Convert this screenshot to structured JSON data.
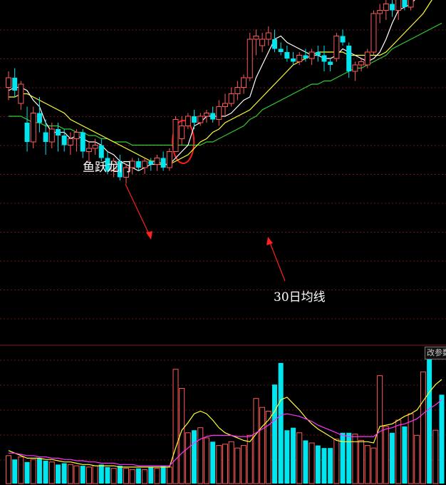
{
  "annotations": {
    "fish_leap": "鱼跃龙门",
    "ma30": "30日均线"
  },
  "volume_panel": {
    "button_label": "改参数"
  },
  "colors": {
    "up": "#ff5a5a",
    "down": "#00e5ee",
    "ma5": "#ffffff",
    "ma10": "#ffff33",
    "ma30": "#33cc33",
    "vol_ma1": "#ffff33",
    "vol_ma2": "#ff33ff",
    "grid": "#6e1414",
    "circle": "#ff1a1a",
    "arrow": "#ff2020"
  },
  "chart_data": {
    "type": "candlestick",
    "price_range": [
      0,
      100
    ],
    "volume_range": [
      0,
      100
    ],
    "grid": true,
    "candles": [
      {
        "o": 75,
        "h": 80,
        "l": 71,
        "c": 78
      },
      {
        "o": 78,
        "h": 81,
        "l": 72,
        "c": 74
      },
      {
        "o": 70,
        "h": 77,
        "l": 68,
        "c": 76
      },
      {
        "o": 64,
        "h": 69,
        "l": 55,
        "c": 58
      },
      {
        "o": 58,
        "h": 69,
        "l": 56,
        "c": 67
      },
      {
        "o": 67,
        "h": 72,
        "l": 61,
        "c": 64
      },
      {
        "o": 61,
        "h": 65,
        "l": 54,
        "c": 58
      },
      {
        "o": 58,
        "h": 64,
        "l": 56,
        "c": 62
      },
      {
        "o": 62,
        "h": 64,
        "l": 55,
        "c": 60
      },
      {
        "o": 60,
        "h": 62,
        "l": 55,
        "c": 57
      },
      {
        "o": 57,
        "h": 61,
        "l": 54,
        "c": 59
      },
      {
        "o": 59,
        "h": 62,
        "l": 55,
        "c": 61
      },
      {
        "o": 61,
        "h": 62,
        "l": 53,
        "c": 55
      },
      {
        "o": 55,
        "h": 58,
        "l": 52,
        "c": 56
      },
      {
        "o": 56,
        "h": 59,
        "l": 54,
        "c": 57
      },
      {
        "o": 57,
        "h": 59,
        "l": 52,
        "c": 53
      },
      {
        "o": 53,
        "h": 55,
        "l": 48,
        "c": 49
      },
      {
        "o": 49,
        "h": 53,
        "l": 47,
        "c": 52
      },
      {
        "o": 52,
        "h": 54,
        "l": 46,
        "c": 47
      },
      {
        "o": 47,
        "h": 51,
        "l": 45,
        "c": 50
      },
      {
        "o": 50,
        "h": 53,
        "l": 48,
        "c": 52
      },
      {
        "o": 52,
        "h": 53,
        "l": 49,
        "c": 50
      },
      {
        "o": 50,
        "h": 53,
        "l": 48,
        "c": 52
      },
      {
        "o": 52,
        "h": 53,
        "l": 49,
        "c": 51
      },
      {
        "o": 51,
        "h": 54,
        "l": 49,
        "c": 53
      },
      {
        "o": 53,
        "h": 55,
        "l": 49,
        "c": 50
      },
      {
        "o": 50,
        "h": 56,
        "l": 49,
        "c": 55
      },
      {
        "o": 55,
        "h": 66,
        "l": 55,
        "c": 65
      },
      {
        "o": 59,
        "h": 66,
        "l": 57,
        "c": 63
      },
      {
        "o": 63,
        "h": 67,
        "l": 62,
        "c": 66
      },
      {
        "o": 66,
        "h": 68,
        "l": 62,
        "c": 64
      },
      {
        "o": 64,
        "h": 67,
        "l": 63,
        "c": 66
      },
      {
        "o": 66,
        "h": 68,
        "l": 64,
        "c": 67
      },
      {
        "o": 67,
        "h": 69,
        "l": 64,
        "c": 65
      },
      {
        "o": 65,
        "h": 71,
        "l": 63,
        "c": 69
      },
      {
        "o": 69,
        "h": 73,
        "l": 66,
        "c": 70
      },
      {
        "o": 70,
        "h": 75,
        "l": 69,
        "c": 73
      },
      {
        "o": 73,
        "h": 77,
        "l": 71,
        "c": 75
      },
      {
        "o": 75,
        "h": 79,
        "l": 73,
        "c": 78
      },
      {
        "o": 78,
        "h": 92,
        "l": 77,
        "c": 90
      },
      {
        "o": 90,
        "h": 93,
        "l": 85,
        "c": 91
      },
      {
        "o": 88,
        "h": 92,
        "l": 86,
        "c": 90
      },
      {
        "o": 90,
        "h": 94,
        "l": 88,
        "c": 92
      },
      {
        "o": 90,
        "h": 93,
        "l": 86,
        "c": 87
      },
      {
        "o": 87,
        "h": 89,
        "l": 85,
        "c": 86
      },
      {
        "o": 86,
        "h": 88,
        "l": 83,
        "c": 84
      },
      {
        "o": 84,
        "h": 86,
        "l": 82,
        "c": 83
      },
      {
        "o": 83,
        "h": 86,
        "l": 82,
        "c": 85
      },
      {
        "o": 85,
        "h": 87,
        "l": 83,
        "c": 84
      },
      {
        "o": 84,
        "h": 87,
        "l": 82,
        "c": 86
      },
      {
        "o": 86,
        "h": 88,
        "l": 83,
        "c": 85
      },
      {
        "o": 85,
        "h": 88,
        "l": 80,
        "c": 83
      },
      {
        "o": 83,
        "h": 84,
        "l": 80,
        "c": 82
      },
      {
        "o": 84,
        "h": 92,
        "l": 83,
        "c": 91
      },
      {
        "o": 91,
        "h": 93,
        "l": 88,
        "c": 89
      },
      {
        "o": 88,
        "h": 89,
        "l": 78,
        "c": 80
      },
      {
        "o": 80,
        "h": 83,
        "l": 77,
        "c": 82
      },
      {
        "o": 82,
        "h": 84,
        "l": 80,
        "c": 83
      },
      {
        "o": 82,
        "h": 87,
        "l": 81,
        "c": 86
      },
      {
        "o": 86,
        "h": 99,
        "l": 85,
        "c": 98
      },
      {
        "o": 98,
        "h": 101,
        "l": 95,
        "c": 99
      },
      {
        "o": 99,
        "h": 103,
        "l": 96,
        "c": 101
      },
      {
        "o": 101,
        "h": 104,
        "l": 97,
        "c": 99
      },
      {
        "o": 99,
        "h": 104,
        "l": 96,
        "c": 103
      },
      {
        "o": 103,
        "h": 105,
        "l": 99,
        "c": 100
      },
      {
        "o": 100,
        "h": 112,
        "l": 99,
        "c": 111
      },
      {
        "o": 111,
        "h": 116,
        "l": 108,
        "c": 114
      },
      {
        "o": 114,
        "h": 121,
        "l": 112,
        "c": 120
      },
      {
        "o": 120,
        "h": 124,
        "l": 114,
        "c": 116
      },
      {
        "o": 116,
        "h": 121,
        "l": 114,
        "c": 119
      },
      {
        "o": 119,
        "h": 122,
        "l": 116,
        "c": 118
      }
    ],
    "ma5": [
      74,
      75,
      75,
      74,
      71,
      69,
      64,
      61,
      61,
      61,
      59,
      60,
      59,
      58,
      58,
      57,
      55,
      54,
      52,
      51,
      50,
      49,
      50,
      51,
      51,
      51,
      51,
      53,
      55,
      57,
      63,
      64,
      66,
      66,
      66,
      66,
      67,
      69,
      71,
      72,
      78,
      82,
      86,
      90,
      91,
      89,
      88,
      87,
      86,
      85,
      85,
      84,
      84,
      85,
      87,
      86,
      85,
      84,
      83,
      84,
      86,
      90,
      95,
      99,
      100,
      101,
      103,
      106,
      110,
      113,
      116
    ],
    "ma10": [
      72,
      72,
      73,
      73,
      72,
      71,
      70,
      69,
      68,
      67,
      65,
      64,
      63,
      62,
      61,
      60,
      59,
      58,
      57,
      56,
      55,
      54,
      53,
      52,
      52,
      51,
      51,
      52,
      53,
      54,
      56,
      58,
      59,
      61,
      62,
      64,
      65,
      66,
      67,
      68,
      70,
      72,
      74,
      76,
      78,
      80,
      82,
      83,
      84,
      85,
      86,
      86,
      86,
      86,
      86,
      85,
      85,
      85,
      85,
      85,
      85,
      86,
      88,
      90,
      92,
      94,
      96,
      98,
      101,
      104,
      106
    ],
    "ma30": [
      66,
      66,
      66,
      65,
      64,
      64,
      63,
      63,
      63,
      62,
      62,
      61,
      61,
      60,
      60,
      59,
      59,
      58,
      58,
      58,
      57,
      57,
      57,
      57,
      57,
      57,
      57,
      57,
      57,
      57,
      57,
      57,
      58,
      58,
      59,
      60,
      61,
      62,
      63,
      65,
      66,
      68,
      69,
      70,
      71,
      72,
      73,
      74,
      75,
      76,
      76,
      77,
      77,
      78,
      79,
      80,
      81,
      81,
      82,
      83,
      84,
      85,
      87,
      88,
      89,
      90,
      91,
      92,
      93,
      94,
      95
    ],
    "volume": [
      22,
      19,
      21,
      17,
      19,
      20,
      18,
      17,
      15,
      16,
      15,
      14,
      14,
      13,
      14,
      15,
      13,
      12,
      14,
      12,
      11,
      12,
      11,
      13,
      12,
      14,
      13,
      90,
      75,
      40,
      42,
      44,
      36,
      33,
      30,
      31,
      33,
      28,
      30,
      38,
      67,
      60,
      57,
      78,
      95,
      42,
      44,
      40,
      34,
      32,
      30,
      28,
      28,
      35,
      40,
      40,
      39,
      34,
      30,
      28,
      85,
      45,
      40,
      50,
      45,
      55,
      38,
      88,
      99,
      42,
      70
    ],
    "vol_ma1": [
      26,
      24,
      22,
      20,
      20,
      20,
      19,
      19,
      18,
      17,
      17,
      16,
      15,
      15,
      14,
      14,
      14,
      14,
      13,
      13,
      13,
      13,
      13,
      13,
      13,
      13,
      13,
      28,
      42,
      48,
      55,
      57,
      55,
      50,
      44,
      40,
      38,
      36,
      34,
      33,
      39,
      45,
      50,
      57,
      66,
      68,
      63,
      58,
      52,
      47,
      43,
      40,
      37,
      34,
      33,
      33,
      33,
      33,
      33,
      32,
      45,
      46,
      47,
      50,
      53,
      55,
      58,
      65,
      72,
      78,
      82
    ],
    "vol_ma2": [
      24,
      24,
      23,
      22,
      22,
      21,
      21,
      20,
      20,
      19,
      19,
      18,
      18,
      17,
      17,
      16,
      16,
      16,
      15,
      15,
      15,
      14,
      14,
      14,
      14,
      14,
      14,
      19,
      24,
      28,
      32,
      35,
      37,
      38,
      38,
      38,
      38,
      37,
      37,
      37,
      40,
      43,
      46,
      50,
      54,
      55,
      54,
      53,
      51,
      49,
      46,
      44,
      42,
      40,
      38,
      37,
      37,
      37,
      37,
      37,
      41,
      43,
      44,
      46,
      47,
      49,
      51,
      55,
      59,
      62,
      66
    ]
  }
}
